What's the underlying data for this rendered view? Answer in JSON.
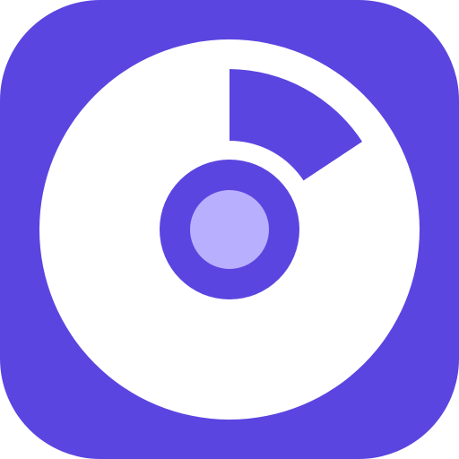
{
  "app_icon": {
    "icon_name": "disc-icon",
    "colors": {
      "tile": "#5b45e0",
      "disc": "#ffffff",
      "ring": "#5b45e0",
      "hub": "#b9afff",
      "shine_wedge": "#5b45e0"
    }
  }
}
